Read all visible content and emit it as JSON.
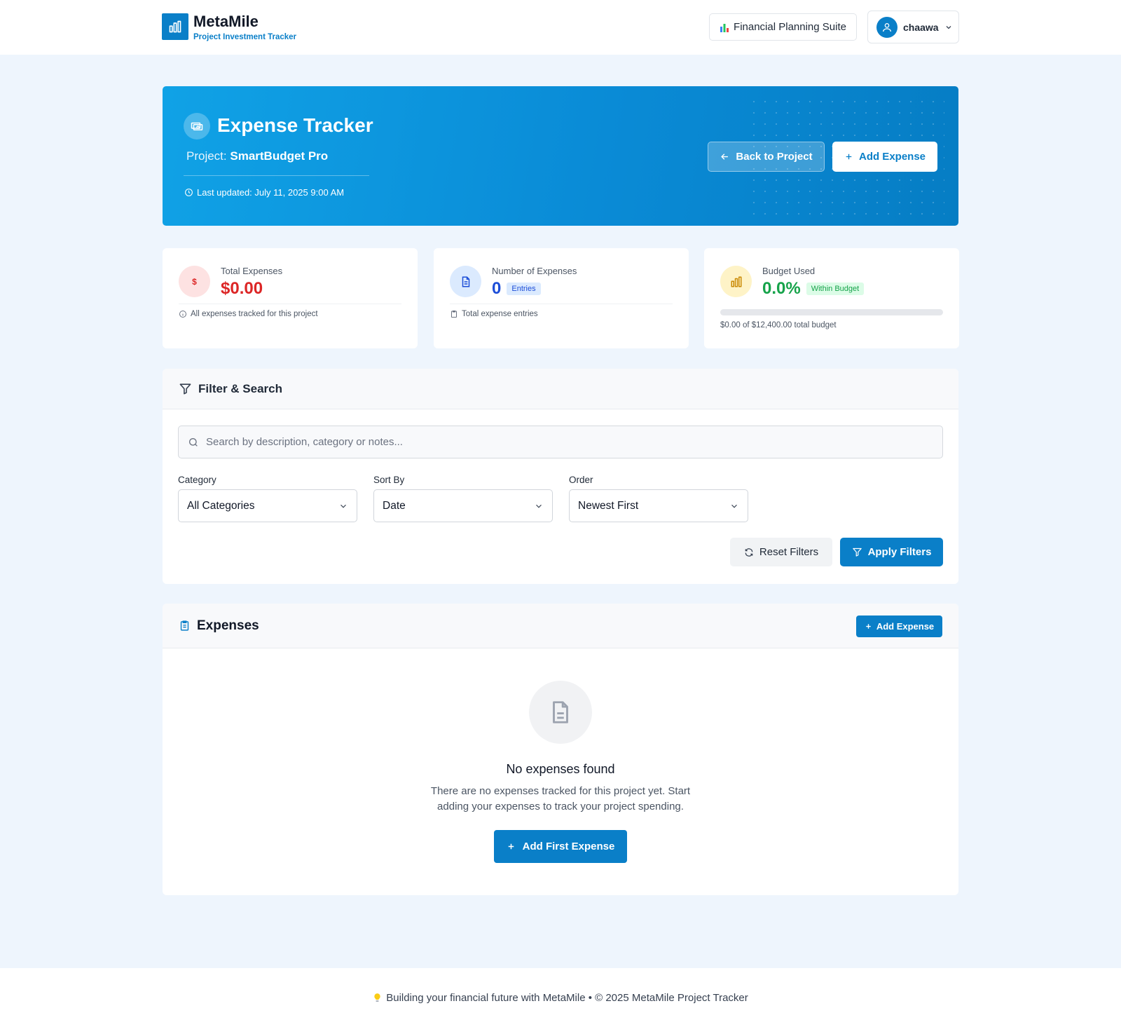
{
  "header": {
    "brand_name": "MetaMile",
    "brand_subtitle": "Project Investment Tracker",
    "suite_label": "Financial Planning Suite",
    "user_name": "chaawa"
  },
  "hero": {
    "title": "Expense Tracker",
    "project_prefix": "Project:",
    "project_name": "SmartBudget Pro",
    "last_updated": "Last updated: July 11, 2025 9:00 AM",
    "back_button": "Back to Project",
    "add_button": "Add Expense"
  },
  "stats": {
    "total": {
      "label": "Total Expenses",
      "value": "$0.00",
      "icon_glyph": "$",
      "note": "All expenses tracked for this project"
    },
    "count": {
      "label": "Number of Expenses",
      "value": "0",
      "badge": "Entries",
      "note": "Total expense entries"
    },
    "budget": {
      "label": "Budget Used",
      "value": "0.0%",
      "badge": "Within Budget",
      "progress_percent": 0,
      "note": "$0.00 of $12,400.00 total budget"
    }
  },
  "filter": {
    "title": "Filter & Search",
    "search_placeholder": "Search by description, category or notes...",
    "category_label": "Category",
    "category_value": "All Categories",
    "sort_label": "Sort By",
    "sort_value": "Date",
    "order_label": "Order",
    "order_value": "Newest First",
    "reset_button": "Reset Filters",
    "apply_button": "Apply Filters"
  },
  "expenses": {
    "title": "Expenses",
    "add_button": "Add Expense",
    "empty_title": "No expenses found",
    "empty_text": "There are no expenses tracked for this project yet. Start adding your expenses to track your project spending.",
    "first_button": "Add First Expense"
  },
  "footer": {
    "text": "Building your financial future with MetaMile • © 2025 MetaMile Project Tracker"
  },
  "colors": {
    "primary": "#0a7fc8",
    "danger": "#dc2626",
    "success": "#16a34a",
    "info": "#1d4ed8",
    "page_bg": "#eef5fd"
  }
}
